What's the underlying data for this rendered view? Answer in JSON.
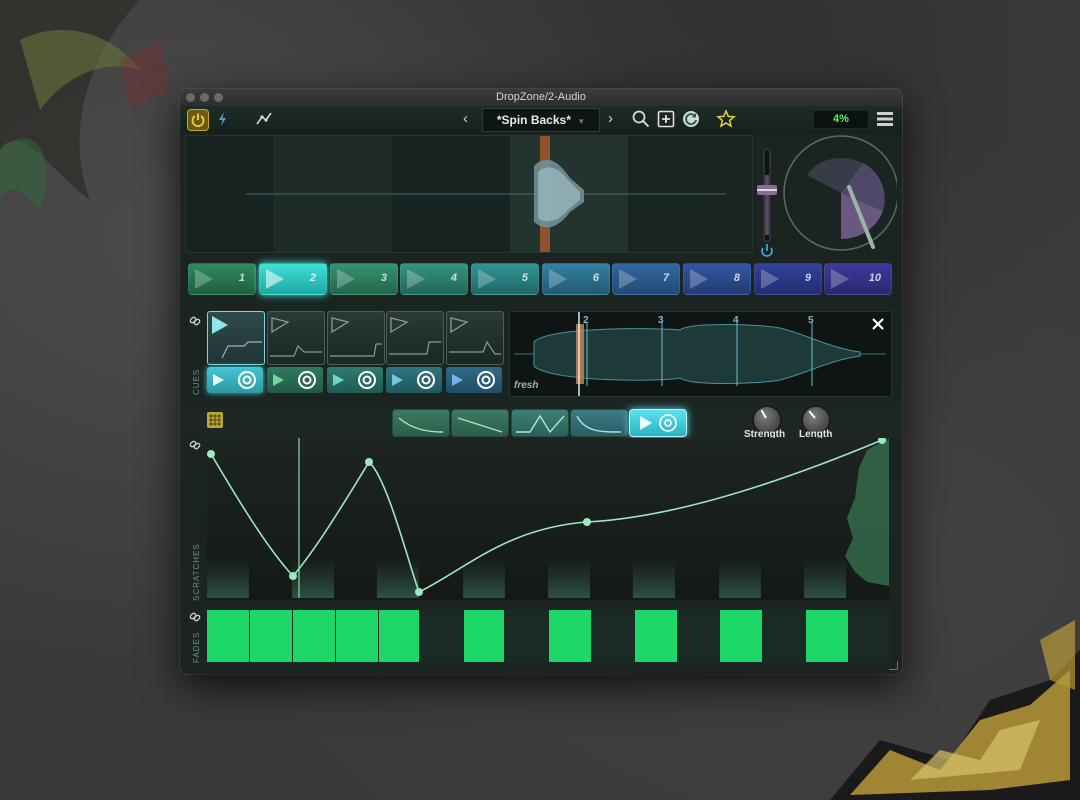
{
  "window": {
    "title": "DropZone/2-Audio"
  },
  "toolbar": {
    "preset_name": "*Spin Backs*",
    "prev_arrow": "‹",
    "next_arrow": "›",
    "cpu_usage": "4%"
  },
  "colors": {
    "accent_yellow": "#c9a81f",
    "green_fill": "#1ed769",
    "cpu_text": "#3bff5a"
  },
  "icons": {
    "power": "power-icon",
    "lightning": "lightning-icon",
    "curve": "curve-icon",
    "search": "search-icon",
    "add": "add-icon",
    "refresh": "refresh-icon",
    "star": "star-icon",
    "menu": "menu-icon",
    "close": "close-icon",
    "link": "link-icon",
    "grid": "grid-icon"
  },
  "pads": [
    {
      "label": "1",
      "color": "#2a7a52",
      "active": false
    },
    {
      "label": "2",
      "color": "#27c7c0",
      "active": true
    },
    {
      "label": "3",
      "color": "#2f8a6a",
      "active": false
    },
    {
      "label": "4",
      "color": "#2f8a78",
      "active": false
    },
    {
      "label": "5",
      "color": "#2d8a8a",
      "active": false
    },
    {
      "label": "6",
      "color": "#2f7796",
      "active": false
    },
    {
      "label": "7",
      "color": "#2e5f96",
      "active": false
    },
    {
      "label": "8",
      "color": "#2f4e96",
      "active": false
    },
    {
      "label": "9",
      "color": "#303d90",
      "active": false
    },
    {
      "label": "10",
      "color": "#3a3590",
      "active": false
    }
  ],
  "cues": {
    "section_label": "CUES",
    "markers": [
      "2",
      "3",
      "4",
      "5"
    ],
    "sample_name": "fresh"
  },
  "scratches": {
    "section_label": "SCRATCHES",
    "knobs": [
      {
        "label": "Strength"
      },
      {
        "label": "Length"
      }
    ]
  },
  "fades": {
    "section_label": "FADES"
  }
}
